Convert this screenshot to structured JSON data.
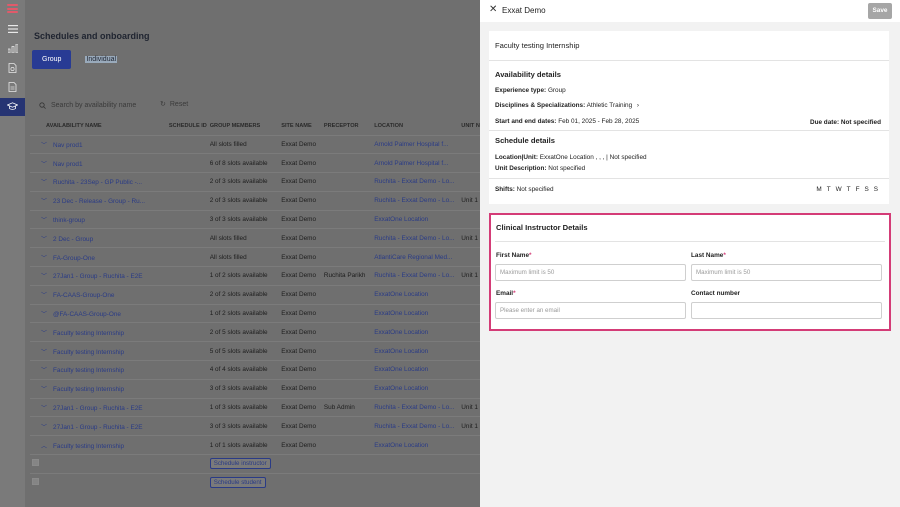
{
  "rail": {
    "icons": [
      "app-logo",
      "menu-icon",
      "analytics-icon",
      "report-icon",
      "document-icon",
      "graduation-icon"
    ]
  },
  "main": {
    "title": "Schedules and onboarding",
    "toggle": {
      "group": "Group",
      "individual": "Individual"
    },
    "search_placeholder": "Search by availability name",
    "reset": "Reset",
    "columns": [
      "AVAILABILITY NAME",
      "SCHEDULE ID",
      "GROUP MEMBERS",
      "SITE NAME",
      "PRECEPTOR",
      "LOCATION",
      "UNIT N"
    ],
    "rows": [
      {
        "name": "Nav prod1",
        "members": "All slots filled",
        "site": "Exxat Demo",
        "preceptor": "",
        "location": "Arnold Palmer Hospital f...",
        "unit": ""
      },
      {
        "name": "Nav prod1",
        "members": "6 of 8 slots available",
        "site": "Exxat Demo",
        "preceptor": "",
        "location": "Arnold Palmer Hospital f...",
        "unit": ""
      },
      {
        "name": "Ruchita - 23Sep - GP Public -...",
        "members": "2 of 3 slots available",
        "site": "Exxat Demo",
        "preceptor": "",
        "location": "Ruchita - Exxat Demo - Lo...",
        "unit": ""
      },
      {
        "name": "23 Dec - Release - Group - Ru...",
        "members": "2 of 3 slots available",
        "site": "Exxat Demo",
        "preceptor": "",
        "location": "Ruchita - Exxat Demo - Lo...",
        "unit": "Unit 1"
      },
      {
        "name": "think-group",
        "members": "3 of 3 slots available",
        "site": "Exxat Demo",
        "preceptor": "",
        "location": "ExxatOne Location",
        "unit": ""
      },
      {
        "name": "2 Dec - Group",
        "members": "All slots filled",
        "site": "Exxat Demo",
        "preceptor": "",
        "location": "Ruchita - Exxat Demo - Lo...",
        "unit": "Unit 1"
      },
      {
        "name": "FA-Group-One",
        "members": "All slots filled",
        "site": "Exxat Demo",
        "preceptor": "",
        "location": "AtlantiCare Regional Med...",
        "unit": ""
      },
      {
        "name": "27Jan1 - Group - Ruchita - E2E",
        "members": "1 of 2 slots available",
        "site": "Exxat Demo",
        "preceptor": "Ruchita Parikh",
        "location": "Ruchita - Exxat Demo - Lo...",
        "unit": "Unit 1"
      },
      {
        "name": "FA-CAAS-Group-One",
        "members": "2 of 2 slots available",
        "site": "Exxat Demo",
        "preceptor": "",
        "location": "ExxatOne Location",
        "unit": ""
      },
      {
        "name": "@FA-CAAS-Group-One",
        "members": "1 of 2 slots available",
        "site": "Exxat Demo",
        "preceptor": "",
        "location": "ExxatOne Location",
        "unit": ""
      },
      {
        "name": "Faculty testing Internship",
        "members": "2 of 5 slots available",
        "site": "Exxat Demo",
        "preceptor": "",
        "location": "ExxatOne Location",
        "unit": ""
      },
      {
        "name": "Faculty testing Internship",
        "members": "5 of 5 slots available",
        "site": "Exxat Demo",
        "preceptor": "",
        "location": "ExxatOne Location",
        "unit": ""
      },
      {
        "name": "Faculty testing Internship",
        "members": "4 of 4 slots available",
        "site": "Exxat Demo",
        "preceptor": "",
        "location": "ExxatOne Location",
        "unit": ""
      },
      {
        "name": "Faculty testing Internship",
        "members": "3 of 3 slots available",
        "site": "Exxat Demo",
        "preceptor": "",
        "location": "ExxatOne Location",
        "unit": ""
      },
      {
        "name": "27Jan1 - Group - Ruchita - E2E",
        "members": "1 of 3 slots available",
        "site": "Exxat Demo",
        "preceptor": "Sub Admin",
        "location": "Ruchita - Exxat Demo - Lo...",
        "unit": "Unit 1"
      },
      {
        "name": "27Jan1 - Group - Ruchita - E2E",
        "members": "3 of 3 slots available",
        "site": "Exxat Demo",
        "preceptor": "",
        "location": "Ruchita - Exxat Demo - Lo...",
        "unit": "Unit 1"
      },
      {
        "name": "Faculty testing Internship",
        "members": "1 of 1 slots available",
        "site": "Exxat Demo",
        "preceptor": "",
        "location": "ExxatOne Location",
        "unit": ""
      }
    ],
    "schedule_instructor": "Schedule instructor",
    "schedule_student": "Schedule student"
  },
  "drawer": {
    "title": "Exxat Demo",
    "save": "Save",
    "internship_name": "Faculty testing Internship",
    "availability": {
      "title": "Availability details",
      "experience_label": "Experience type:",
      "experience_value": "Group",
      "disciplines_label": "Disciplines & Specializations:",
      "disciplines_value": "Athletic Training",
      "dates_label": "Start and end dates:",
      "dates_value": "Feb 01, 2025 - Feb 28, 2025",
      "due_label": "Due date:",
      "due_value": "Not specified"
    },
    "schedule": {
      "title": "Schedule details",
      "location_label": "Location|Unit:",
      "location_value": "ExxatOne Location , , , | Not specified",
      "unit_desc_label": "Unit Description:",
      "unit_desc_value": "Not specified",
      "shifts_label": "Shifts:",
      "shifts_value": "Not specified",
      "days": [
        "M",
        "T",
        "W",
        "T",
        "F",
        "S",
        "S"
      ]
    },
    "instructor": {
      "title": "Clinical Instructor Details",
      "first_name_label": "First Name",
      "last_name_label": "Last Name",
      "email_label": "Email",
      "contact_label": "Contact number",
      "required_mark": "*",
      "first_name_placeholder": "Maximum limit is 50",
      "last_name_placeholder": "Maximum limit is 50",
      "email_placeholder": "Please enter an email",
      "contact_placeholder": ""
    },
    "accent_color": "#d43c77",
    "brand_color": "#283b94"
  }
}
